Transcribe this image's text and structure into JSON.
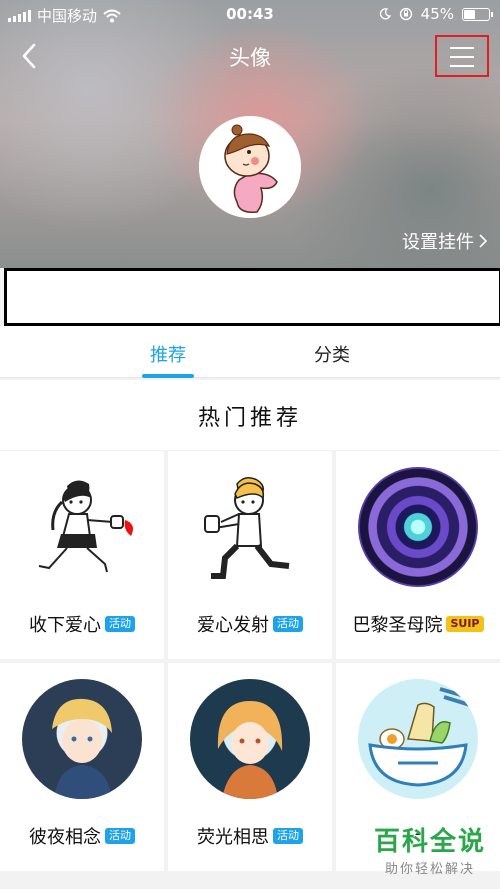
{
  "status": {
    "carrier": "中国移动",
    "time": "00:43",
    "battery": "45%",
    "battery_level": 0.45
  },
  "nav": {
    "title": "头像"
  },
  "header": {
    "pendant_label": "设置挂件"
  },
  "tabs": [
    {
      "label": "推荐",
      "active": true
    },
    {
      "label": "分类",
      "active": false
    }
  ],
  "section": {
    "title": "热门推荐"
  },
  "items": [
    {
      "name": "收下爱心",
      "badge": "活动"
    },
    {
      "name": "爱心发射",
      "badge": "活动"
    },
    {
      "name": "巴黎圣母院",
      "badge": "SUIP"
    },
    {
      "name": "彼夜相念",
      "badge": "活动"
    },
    {
      "name": "荧光相思",
      "badge": "活动"
    },
    {
      "name": "-"
    }
  ],
  "watermark": {
    "main": "百科全说",
    "sub": "助你轻松解决"
  },
  "colors": {
    "accent": "#1fa3e8",
    "highlight_box": "#e02020",
    "suip_badge": "#f3c21a"
  }
}
